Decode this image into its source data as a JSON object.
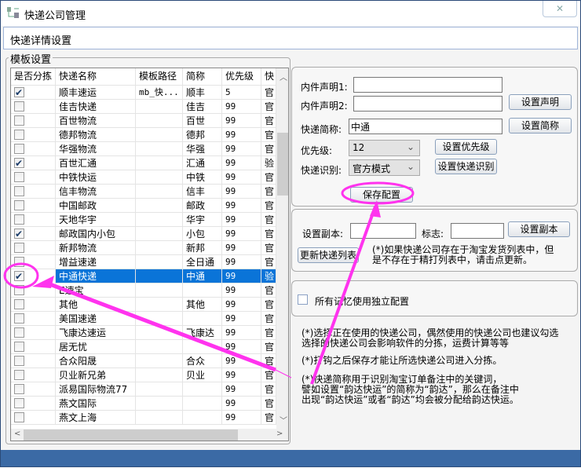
{
  "window": {
    "title": "快递公司管理",
    "close_icon": "close-icon"
  },
  "header": {
    "title": "快递详情设置"
  },
  "template_group": {
    "label": "模板设置",
    "columns": [
      "是否分拣",
      "快递名称",
      "模板路径",
      "简称",
      "优先级",
      "快"
    ],
    "rows": [
      {
        "checked": true,
        "name": "顺丰速运",
        "path": "mb_快...",
        "short": "顺丰",
        "priority": "5",
        "mode": "官"
      },
      {
        "checked": false,
        "name": "佳吉快递",
        "path": "",
        "short": "佳吉",
        "priority": "99",
        "mode": "官"
      },
      {
        "checked": false,
        "name": "百世物流",
        "path": "",
        "short": "百世",
        "priority": "99",
        "mode": "官"
      },
      {
        "checked": false,
        "name": "德邦物流",
        "path": "",
        "short": "德邦",
        "priority": "99",
        "mode": "官"
      },
      {
        "checked": false,
        "name": "华强物流",
        "path": "",
        "short": "华强",
        "priority": "99",
        "mode": "官"
      },
      {
        "checked": true,
        "name": "百世汇通",
        "path": "",
        "short": "汇通",
        "priority": "99",
        "mode": "验"
      },
      {
        "checked": false,
        "name": "中铁快运",
        "path": "",
        "short": "中铁",
        "priority": "99",
        "mode": "官"
      },
      {
        "checked": false,
        "name": "信丰物流",
        "path": "",
        "short": "信丰",
        "priority": "99",
        "mode": "官"
      },
      {
        "checked": false,
        "name": "中国邮政",
        "path": "",
        "short": "邮政",
        "priority": "99",
        "mode": "官"
      },
      {
        "checked": false,
        "name": "天地华宇",
        "path": "",
        "short": "华宇",
        "priority": "99",
        "mode": "官"
      },
      {
        "checked": true,
        "name": "邮政国内小包",
        "path": "",
        "short": "小包",
        "priority": "99",
        "mode": "官"
      },
      {
        "checked": false,
        "name": "新邦物流",
        "path": "",
        "short": "新邦",
        "priority": "99",
        "mode": "官"
      },
      {
        "checked": false,
        "name": "增益速递",
        "path": "",
        "short": "全日通",
        "priority": "99",
        "mode": "官"
      },
      {
        "checked": true,
        "selected": true,
        "name": "中通快递",
        "path": "",
        "short": "中通",
        "priority": "99",
        "mode": "验"
      },
      {
        "checked": false,
        "name": "E速宝",
        "path": "",
        "short": "",
        "priority": "99",
        "mode": "官"
      },
      {
        "checked": false,
        "name": "其他",
        "path": "",
        "short": "其他",
        "priority": "99",
        "mode": "官"
      },
      {
        "checked": false,
        "name": "美国速递",
        "path": "",
        "short": "",
        "priority": "99",
        "mode": "官"
      },
      {
        "checked": false,
        "name": "飞康达速运",
        "path": "",
        "short": "飞康达",
        "priority": "99",
        "mode": "官"
      },
      {
        "checked": false,
        "name": "居无忧",
        "path": "",
        "short": "",
        "priority": "99",
        "mode": "官"
      },
      {
        "checked": false,
        "name": "合众阳晟",
        "path": "",
        "short": "合众",
        "priority": "99",
        "mode": "官"
      },
      {
        "checked": false,
        "name": "贝业新兄弟",
        "path": "",
        "short": "贝业",
        "priority": "99",
        "mode": "官"
      },
      {
        "checked": false,
        "name": "派易国际物流77",
        "path": "",
        "short": "",
        "priority": "99",
        "mode": "官"
      },
      {
        "checked": false,
        "name": "燕文国际",
        "path": "",
        "short": "",
        "priority": "99",
        "mode": "官"
      },
      {
        "checked": false,
        "name": "燕文上海",
        "path": "",
        "short": "",
        "priority": "99",
        "mode": "官"
      }
    ]
  },
  "config": {
    "inner1_label": "内件声明1:",
    "inner1_value": "",
    "inner2_label": "内件声明2:",
    "inner2_value": "",
    "set_declare": "设置声明",
    "short_label": "快递简称:",
    "short_value": "中通",
    "set_short": "设置简称",
    "priority_label": "优先级:",
    "priority_value": "12",
    "set_priority": "设置优先级",
    "recog_label": "快递识别:",
    "recog_value": "官方模式",
    "set_recog": "设置快递识别",
    "save": "保存配置"
  },
  "copy": {
    "copy_label": "设置副本:",
    "copy_value": "",
    "flag_label": "标志:",
    "flag_value": "",
    "set_copy": "设置副本",
    "update_list": "更新快递列表",
    "note": "(*)如果快递公司存在于淘宝发货列表中，但\n是不存在于精打列表中，请击点更新。"
  },
  "independent": {
    "checked": false,
    "label": "所有记忆使用独立配置"
  },
  "notes": [
    "(*)选择正在使用的快递公司，偶然使用的快递公司也建议勾选\n选择的快递公司会影响软件的分拣，运费计算等等",
    "(*)打钩之后保存才能让所选快递公司进入分拣。",
    "(*)快递简称用于识别淘宝订单备注中的关键词，\n譬如设置“韵达快运”的简称为“韵达”，那么在备注中\n出现“韵达快运”或者“韵达”均会被分配给韵达快运。"
  ],
  "colors": {
    "selection": "#0a74d8",
    "annotation": "#ff33ee",
    "status_bar": "#3b6aa5"
  }
}
